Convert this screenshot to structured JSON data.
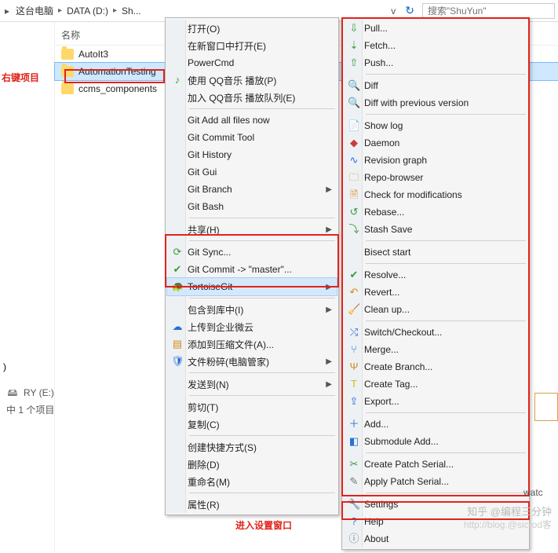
{
  "breadcrumb": {
    "root": "这台电脑",
    "drive": "DATA (D:)",
    "folder": "Sh...",
    "chev": "›"
  },
  "search": {
    "placeholder": "搜索\"ShuYun\""
  },
  "column_header": "名称",
  "files": [
    {
      "name": "AutoIt3"
    },
    {
      "name": "AutomationTesting",
      "selected": true
    },
    {
      "name": "ccms_components"
    }
  ],
  "annotations": {
    "right_click_label": "右键项目",
    "enter_settings_label": "进入设置窗口"
  },
  "drive_label": "RY (E:)",
  "status_text": "中 1 个项目",
  "ctx1": {
    "open": "打开(O)",
    "open_new": "在新窗口中打开(E)",
    "powercmd": "PowerCmd",
    "qqmusic_play": "使用 QQ音乐 播放(P)",
    "qqmusic_queue": "加入 QQ音乐 播放队列(E)",
    "git_add_all": "Git Add all files now",
    "git_commit_tool": "Git Commit Tool",
    "git_history": "Git History",
    "git_gui": "Git Gui",
    "git_branch": "Git Branch",
    "git_bash": "Git Bash",
    "share": "共享(H)",
    "git_sync": "Git Sync...",
    "git_commit_master": "Git Commit -> \"master\"...",
    "tortoisegit": "TortoiseGit",
    "include_lib": "包含到库中(I)",
    "upload_wework": "上传到企业微云",
    "add_archive": "添加到压缩文件(A)...",
    "shred": "文件粉碎(电脑管家)",
    "send_to": "发送到(N)",
    "cut": "剪切(T)",
    "copy": "复制(C)",
    "create_shortcut": "创建快捷方式(S)",
    "delete": "删除(D)",
    "rename": "重命名(M)",
    "properties": "属性(R)"
  },
  "ctx2": {
    "pull": "Pull...",
    "fetch": "Fetch...",
    "push": "Push...",
    "diff": "Diff",
    "diff_prev": "Diff with previous version",
    "show_log": "Show log",
    "daemon": "Daemon",
    "revision_graph": "Revision graph",
    "repo_browser": "Repo-browser",
    "check_mod": "Check for modifications",
    "rebase": "Rebase...",
    "stash_save": "Stash Save",
    "bisect_start": "Bisect start",
    "resolve": "Resolve...",
    "revert": "Revert...",
    "clean_up": "Clean up...",
    "switch": "Switch/Checkout...",
    "merge": "Merge...",
    "create_branch": "Create Branch...",
    "create_tag": "Create Tag...",
    "export": "Export...",
    "add": "Add...",
    "submodule_add": "Submodule Add...",
    "create_patch": "Create Patch Serial...",
    "apply_patch": "Apply Patch Serial...",
    "settings": "Settings",
    "help": "Help",
    "about": "About"
  },
  "watermark": "知乎 @编程三分钟",
  "watermark2": "http://blog.@sicrod客",
  "sidecut_text": "watc"
}
